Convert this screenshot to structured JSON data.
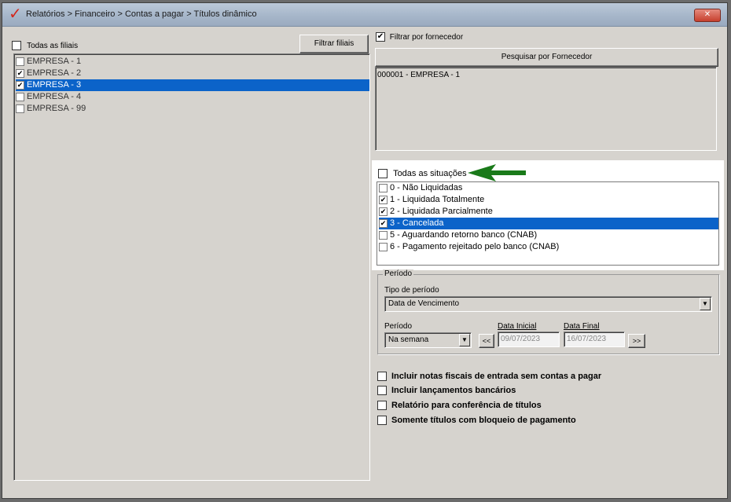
{
  "window": {
    "title": "Relatórios > Financeiro > Contas a pagar > Títulos dinâmico",
    "app_icon": "checkmark-logo-icon",
    "close_label": "✕"
  },
  "filiais": {
    "all_label": "Todas as filiais",
    "all_checked": false,
    "filter_button": "Filtrar filiais",
    "items": [
      {
        "label": "EMPRESA - 1",
        "checked": false,
        "selected": false
      },
      {
        "label": "EMPRESA - 2",
        "checked": true,
        "selected": false
      },
      {
        "label": "EMPRESA - 3",
        "checked": true,
        "selected": true
      },
      {
        "label": "EMPRESA - 4",
        "checked": false,
        "selected": false
      },
      {
        "label": "EMPRESA - 99",
        "checked": false,
        "selected": false
      }
    ]
  },
  "fornecedor": {
    "filter_label": "Filtrar por fornecedor",
    "filter_checked": true,
    "search_button": "Pesquisar por Fornecedor",
    "items": [
      "000001 - EMPRESA - 1"
    ]
  },
  "situacoes": {
    "all_label": "Todas as situações",
    "all_checked": false,
    "arrow_color": "#1a7a1a",
    "items": [
      {
        "label": "0 - Não Liquidadas",
        "checked": false,
        "selected": false
      },
      {
        "label": "1 - Liquidada Totalmente",
        "checked": true,
        "selected": false
      },
      {
        "label": "2 - Liquidada Parcialmente",
        "checked": true,
        "selected": false
      },
      {
        "label": "3 - Cancelada",
        "checked": true,
        "selected": true
      },
      {
        "label": "5 - Aguardando retorno banco (CNAB)",
        "checked": false,
        "selected": false
      },
      {
        "label": "6 - Pagamento rejeitado pelo banco (CNAB)",
        "checked": false,
        "selected": false
      }
    ]
  },
  "periodo": {
    "group_label": "Período",
    "tipo_label": "Tipo de período",
    "tipo_value": "Data de Vencimento",
    "periodo_label": "Período",
    "periodo_value": "Na semana",
    "prev_button": "<<",
    "next_button": ">>",
    "data_inicial_label": "Data Inicial",
    "data_inicial": "09/07/2023",
    "data_final_label": "Data Final",
    "data_final": "16/07/2023"
  },
  "options": [
    {
      "label": "Incluir notas fiscais de entrada sem contas a pagar",
      "checked": false
    },
    {
      "label": "Incluir lançamentos bancários",
      "checked": false
    },
    {
      "label": "Relatório para conferência de títulos",
      "checked": false
    },
    {
      "label": "Somente títulos com bloqueio de pagamento",
      "checked": false
    }
  ]
}
